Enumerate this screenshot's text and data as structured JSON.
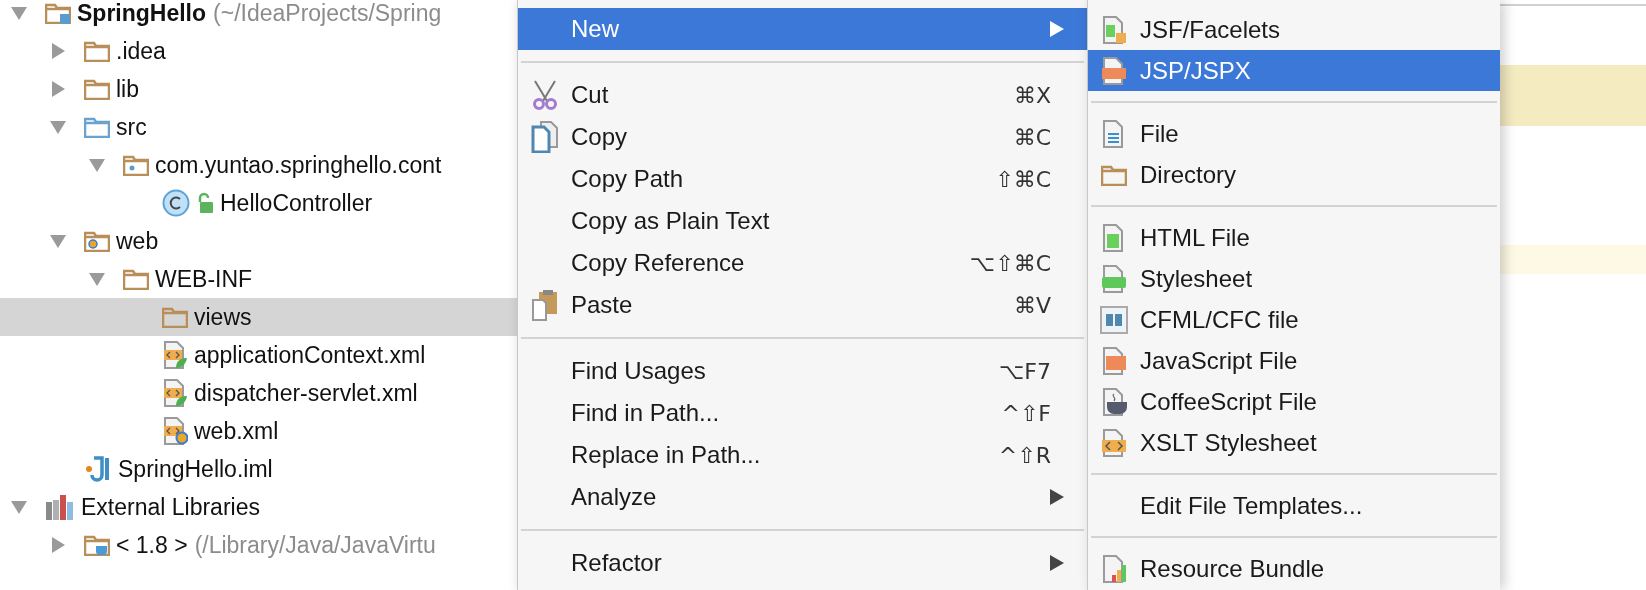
{
  "project_tree": {
    "items": [
      {
        "label": "SpringHello",
        "detail": "(~/IdeaProjects/Spring",
        "kind": "module",
        "expanded": true,
        "selected": false,
        "children": [
          {
            "label": ".idea",
            "kind": "folder",
            "expanded": false,
            "selected": false
          },
          {
            "label": "lib",
            "kind": "folder",
            "expanded": false,
            "selected": false
          },
          {
            "label": "src",
            "kind": "source",
            "expanded": true,
            "selected": false,
            "children": [
              {
                "label": "com.yuntao.springhello.cont",
                "kind": "package",
                "expanded": true,
                "selected": false,
                "children": [
                  {
                    "label": "HelloController",
                    "kind": "class",
                    "selected": false
                  }
                ]
              }
            ]
          },
          {
            "label": "web",
            "kind": "web",
            "expanded": true,
            "selected": false,
            "children": [
              {
                "label": "WEB-INF",
                "kind": "folder",
                "expanded": true,
                "selected": false,
                "children": [
                  {
                    "label": "views",
                    "kind": "folder",
                    "selected": true
                  },
                  {
                    "label": "applicationContext.xml",
                    "kind": "xml_spring",
                    "selected": false
                  },
                  {
                    "label": "dispatcher-servlet.xml",
                    "kind": "xml_spring",
                    "selected": false
                  },
                  {
                    "label": "web.xml",
                    "kind": "xml_web",
                    "selected": false
                  }
                ]
              }
            ]
          },
          {
            "label": "SpringHello.iml",
            "kind": "iml",
            "selected": false
          }
        ]
      },
      {
        "label": "External Libraries",
        "kind": "libraries",
        "expanded": true,
        "selected": false,
        "children": [
          {
            "label": "< 1.8 >",
            "detail": "(/Library/Java/JavaVirtu",
            "kind": "sdk",
            "expanded": false,
            "selected": false
          }
        ]
      }
    ]
  },
  "context_menu": {
    "groups": [
      [
        {
          "label": "New",
          "kind": "plain",
          "submenu": true,
          "selected": true
        }
      ],
      [
        {
          "label": "Cut",
          "kind": "cut",
          "shortcut": "⌘X",
          "submenu": false,
          "selected": false
        },
        {
          "label": "Copy",
          "kind": "copy",
          "shortcut": "⌘C",
          "submenu": false,
          "selected": false
        },
        {
          "label": "Copy Path",
          "kind": "plain",
          "shortcut": "⇧⌘C",
          "submenu": false,
          "selected": false
        },
        {
          "label": "Copy as Plain Text",
          "kind": "plain",
          "submenu": false,
          "selected": false
        },
        {
          "label": "Copy Reference",
          "kind": "plain",
          "shortcut": "⌥⇧⌘C",
          "submenu": false,
          "selected": false
        },
        {
          "label": "Paste",
          "kind": "paste",
          "shortcut": "⌘V",
          "submenu": false,
          "selected": false
        }
      ],
      [
        {
          "label": "Find Usages",
          "kind": "plain",
          "shortcut": "⌥F7",
          "submenu": false,
          "selected": false
        },
        {
          "label": "Find in Path...",
          "kind": "plain",
          "shortcut": "^⇧F",
          "submenu": false,
          "selected": false
        },
        {
          "label": "Replace in Path...",
          "kind": "plain",
          "shortcut": "^⇧R",
          "submenu": false,
          "selected": false
        },
        {
          "label": "Analyze",
          "kind": "plain",
          "submenu": true,
          "selected": false
        }
      ],
      [
        {
          "label": "Refactor",
          "kind": "plain",
          "submenu": true,
          "selected": false
        }
      ]
    ]
  },
  "new_submenu": {
    "groups": [
      [
        {
          "label": "JSF/Facelets",
          "kind": "jsf",
          "selected": false
        },
        {
          "label": "JSP/JSPX",
          "kind": "jsp",
          "selected": true
        }
      ],
      [
        {
          "label": "File",
          "kind": "file",
          "selected": false
        },
        {
          "label": "Directory",
          "kind": "directory",
          "selected": false
        }
      ],
      [
        {
          "label": "HTML File",
          "kind": "html",
          "selected": false
        },
        {
          "label": "Stylesheet",
          "kind": "css",
          "selected": false
        },
        {
          "label": "CFML/CFC file",
          "kind": "cfml",
          "selected": false
        },
        {
          "label": "JavaScript File",
          "kind": "js",
          "selected": false
        },
        {
          "label": "CoffeeScript File",
          "kind": "coffee",
          "selected": false
        },
        {
          "label": "XSLT Stylesheet",
          "kind": "xslt",
          "selected": false
        }
      ],
      [
        {
          "label": "Edit File Templates...",
          "kind": "plain",
          "selected": false
        }
      ],
      [
        {
          "label": "Resource Bundle",
          "kind": "bundle",
          "selected": false
        }
      ]
    ]
  }
}
